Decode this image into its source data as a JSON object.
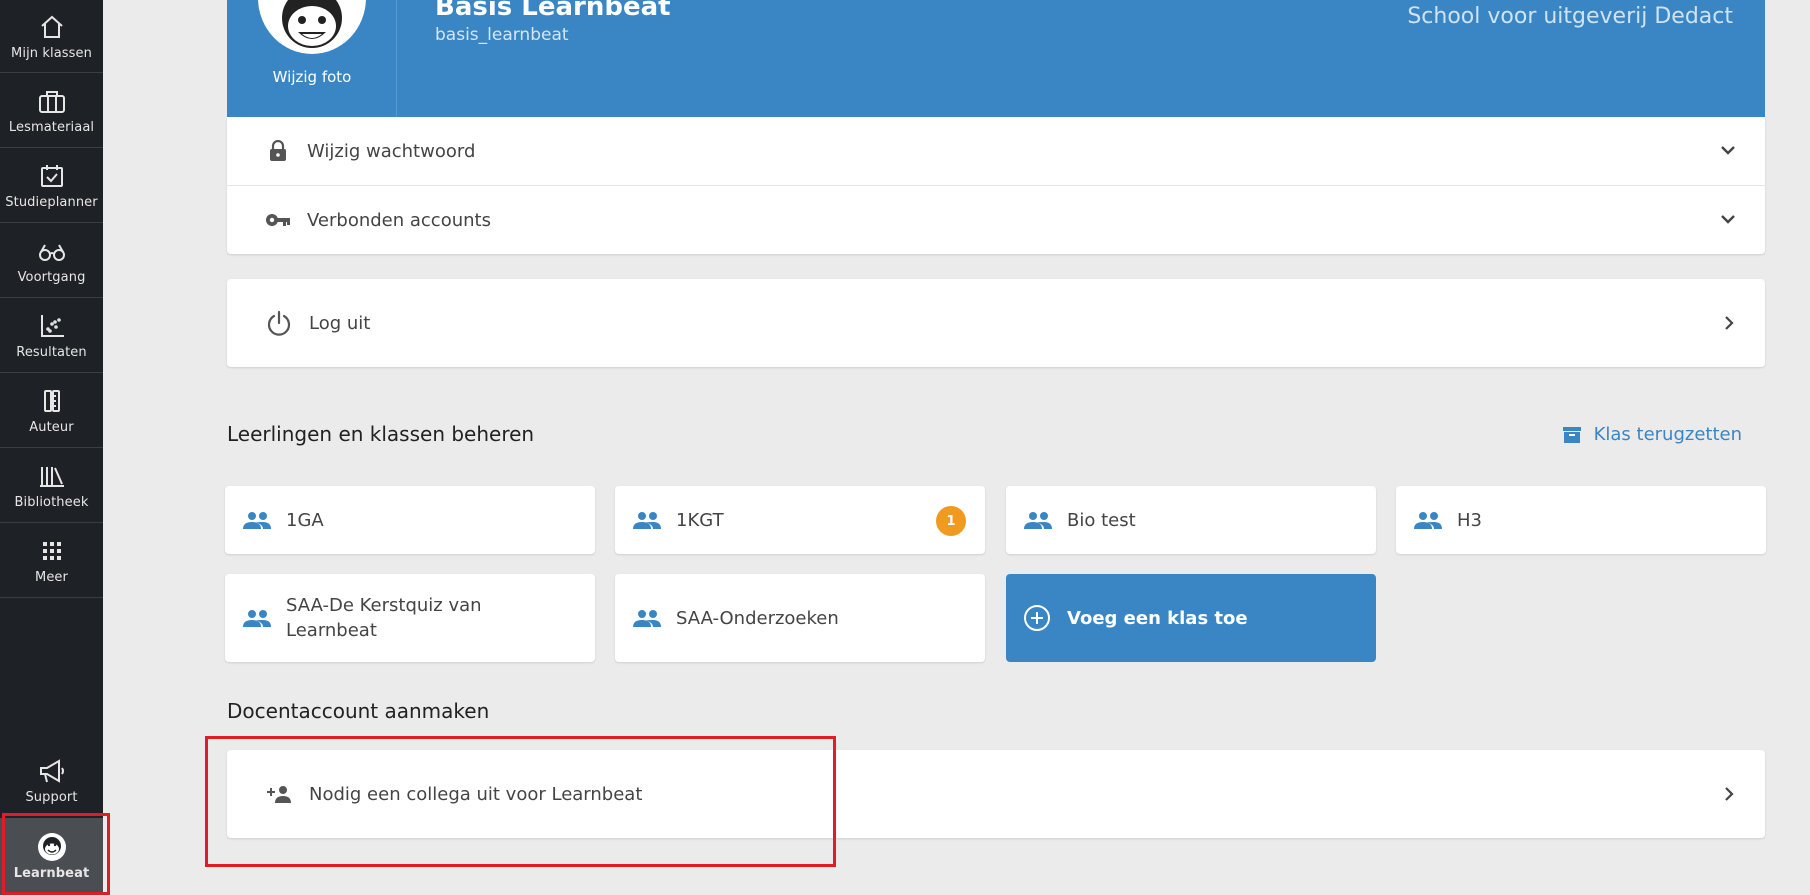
{
  "sidebar": {
    "items": [
      {
        "label": "Mijn klassen",
        "icon": "home-icon"
      },
      {
        "label": "Lesmateriaal",
        "icon": "briefcase-icon"
      },
      {
        "label": "Studieplanner",
        "icon": "calendar-check-icon"
      },
      {
        "label": "Voortgang",
        "icon": "glasses-icon"
      },
      {
        "label": "Resultaten",
        "icon": "scatter-chart-icon"
      },
      {
        "label": "Auteur",
        "icon": "pencil-ruler-icon"
      },
      {
        "label": "Bibliotheek",
        "icon": "books-icon"
      },
      {
        "label": "Meer",
        "icon": "grid-dots-icon"
      }
    ],
    "support": {
      "label": "Support",
      "icon": "megaphone-icon"
    },
    "account": {
      "label": "Learnbeat",
      "icon": "monkey-avatar-icon"
    }
  },
  "profile": {
    "change_photo": "Wijzig foto",
    "name": "Basis Learnbeat",
    "username": "basis_learnbeat",
    "school": "School voor uitgeverij Dedact"
  },
  "settings": {
    "change_password": "Wijzig wachtwoord",
    "connected_accounts": "Verbonden accounts",
    "logout": "Log uit"
  },
  "classes": {
    "title": "Leerlingen en klassen beheren",
    "restore_label": "Klas terugzetten",
    "items": [
      {
        "label": "1GA"
      },
      {
        "label": "1KGT",
        "badge": "1"
      },
      {
        "label": "Bio test"
      },
      {
        "label": "H3"
      },
      {
        "label": "SAA-De Kerstquiz van Learnbeat"
      },
      {
        "label": "SAA-Onderzoeken"
      }
    ],
    "add_label": "Voeg een klas toe"
  },
  "teacher_account": {
    "title": "Docentaccount aanmaken",
    "invite_label": "Nodig een collega uit voor Learnbeat"
  },
  "colors": {
    "primary": "#3a86c4",
    "sidebar": "#1e2125",
    "badge": "#f09a1f",
    "highlight": "#e11c24"
  }
}
